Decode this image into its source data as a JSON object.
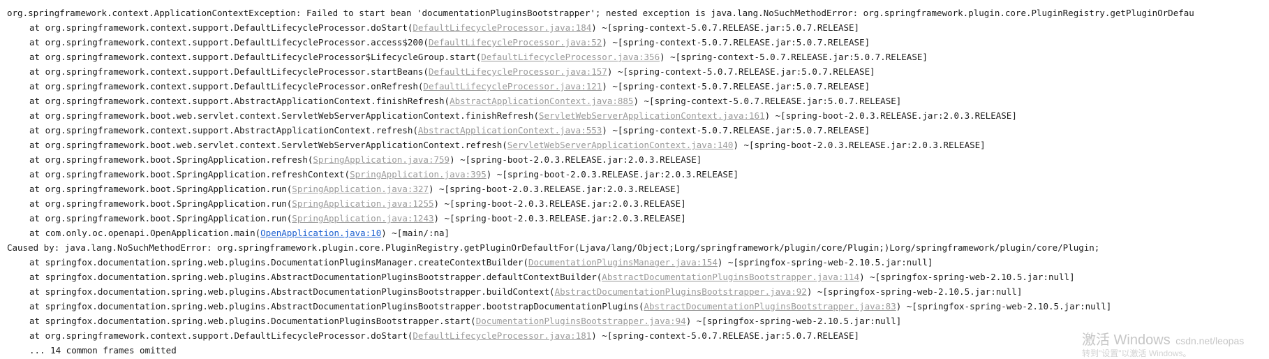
{
  "console": {
    "lines": [
      {
        "text": "org.springframework.context.ApplicationContextException: Failed to start bean 'documentationPluginsBootstrapper'; nested exception is java.lang.NoSuchMethodError: org.springframework.plugin.core.PluginRegistry.getPluginOrDefau",
        "indent": false
      },
      {
        "text": "at org.springframework.context.support.DefaultLifecycleProcessor.doStart(",
        "link": "DefaultLifecycleProcessor.java:184",
        "suffix": ") ~[spring-context-5.0.7.RELEASE.jar:5.0.7.RELEASE]",
        "indent": true
      },
      {
        "text": "at org.springframework.context.support.DefaultLifecycleProcessor.access$200(",
        "link": "DefaultLifecycleProcessor.java:52",
        "suffix": ") ~[spring-context-5.0.7.RELEASE.jar:5.0.7.RELEASE]",
        "indent": true
      },
      {
        "text": "at org.springframework.context.support.DefaultLifecycleProcessor$LifecycleGroup.start(",
        "link": "DefaultLifecycleProcessor.java:356",
        "suffix": ") ~[spring-context-5.0.7.RELEASE.jar:5.0.7.RELEASE]",
        "indent": true
      },
      {
        "text": "at org.springframework.context.support.DefaultLifecycleProcessor.startBeans(",
        "link": "DefaultLifecycleProcessor.java:157",
        "suffix": ") ~[spring-context-5.0.7.RELEASE.jar:5.0.7.RELEASE]",
        "indent": true
      },
      {
        "text": "at org.springframework.context.support.DefaultLifecycleProcessor.onRefresh(",
        "link": "DefaultLifecycleProcessor.java:121",
        "suffix": ") ~[spring-context-5.0.7.RELEASE.jar:5.0.7.RELEASE]",
        "indent": true
      },
      {
        "text": "at org.springframework.context.support.AbstractApplicationContext.finishRefresh(",
        "link": "AbstractApplicationContext.java:885",
        "suffix": ") ~[spring-context-5.0.7.RELEASE.jar:5.0.7.RELEASE]",
        "indent": true
      },
      {
        "text": "at org.springframework.boot.web.servlet.context.ServletWebServerApplicationContext.finishRefresh(",
        "link": "ServletWebServerApplicationContext.java:161",
        "suffix": ") ~[spring-boot-2.0.3.RELEASE.jar:2.0.3.RELEASE]",
        "indent": true
      },
      {
        "text": "at org.springframework.context.support.AbstractApplicationContext.refresh(",
        "link": "AbstractApplicationContext.java:553",
        "suffix": ") ~[spring-context-5.0.7.RELEASE.jar:5.0.7.RELEASE]",
        "indent": true
      },
      {
        "text": "at org.springframework.boot.web.servlet.context.ServletWebServerApplicationContext.refresh(",
        "link": "ServletWebServerApplicationContext.java:140",
        "suffix": ") ~[spring-boot-2.0.3.RELEASE.jar:2.0.3.RELEASE]",
        "indent": true
      },
      {
        "text": "at org.springframework.boot.SpringApplication.refresh(",
        "link": "SpringApplication.java:759",
        "suffix": ") ~[spring-boot-2.0.3.RELEASE.jar:2.0.3.RELEASE]",
        "indent": true
      },
      {
        "text": "at org.springframework.boot.SpringApplication.refreshContext(",
        "link": "SpringApplication.java:395",
        "suffix": ") ~[spring-boot-2.0.3.RELEASE.jar:2.0.3.RELEASE]",
        "indent": true
      },
      {
        "text": "at org.springframework.boot.SpringApplication.run(",
        "link": "SpringApplication.java:327",
        "suffix": ") ~[spring-boot-2.0.3.RELEASE.jar:2.0.3.RELEASE]",
        "indent": true
      },
      {
        "text": "at org.springframework.boot.SpringApplication.run(",
        "link": "SpringApplication.java:1255",
        "suffix": ") ~[spring-boot-2.0.3.RELEASE.jar:2.0.3.RELEASE]",
        "indent": true
      },
      {
        "text": "at org.springframework.boot.SpringApplication.run(",
        "link": "SpringApplication.java:1243",
        "suffix": ") ~[spring-boot-2.0.3.RELEASE.jar:2.0.3.RELEASE]",
        "indent": true
      },
      {
        "text": "at com.only.oc.openapi.OpenApplication.main(",
        "link": "OpenApplication.java:10",
        "suffix": ") ~[main/:na]",
        "indent": true,
        "active": true
      },
      {
        "text": "Caused by: java.lang.NoSuchMethodError: org.springframework.plugin.core.PluginRegistry.getPluginOrDefaultFor(Ljava/lang/Object;Lorg/springframework/plugin/core/Plugin;)Lorg/springframework/plugin/core/Plugin;",
        "indent": false
      },
      {
        "text": "at springfox.documentation.spring.web.plugins.DocumentationPluginsManager.createContextBuilder(",
        "link": "DocumentationPluginsManager.java:154",
        "suffix": ") ~[springfox-spring-web-2.10.5.jar:null]",
        "indent": true
      },
      {
        "text": "at springfox.documentation.spring.web.plugins.AbstractDocumentationPluginsBootstrapper.defaultContextBuilder(",
        "link": "AbstractDocumentationPluginsBootstrapper.java:114",
        "suffix": ") ~[springfox-spring-web-2.10.5.jar:null]",
        "indent": true
      },
      {
        "text": "at springfox.documentation.spring.web.plugins.AbstractDocumentationPluginsBootstrapper.buildContext(",
        "link": "AbstractDocumentationPluginsBootstrapper.java:92",
        "suffix": ") ~[springfox-spring-web-2.10.5.jar:null]",
        "indent": true
      },
      {
        "text": "at springfox.documentation.spring.web.plugins.AbstractDocumentationPluginsBootstrapper.bootstrapDocumentationPlugins(",
        "link": "AbstractDocumentationPluginsBootstrapper.java:83",
        "suffix": ") ~[springfox-spring-web-2.10.5.jar:null]",
        "indent": true
      },
      {
        "text": "at springfox.documentation.spring.web.plugins.DocumentationPluginsBootstrapper.start(",
        "link": "DocumentationPluginsBootstrapper.java:94",
        "suffix": ") ~[springfox-spring-web-2.10.5.jar:null]",
        "indent": true
      },
      {
        "text": "at org.springframework.context.support.DefaultLifecycleProcessor.doStart(",
        "link": "DefaultLifecycleProcessor.java:181",
        "suffix": ") ~[spring-context-5.0.7.RELEASE.jar:5.0.7.RELEASE]",
        "indent": true
      },
      {
        "text": "... 14 common frames omitted",
        "indent": true
      }
    ]
  },
  "watermark": {
    "text": "激活 Windows",
    "url": "csdn.net/leopas",
    "subtext": "转到\"设置\"以激活 Windows。"
  }
}
